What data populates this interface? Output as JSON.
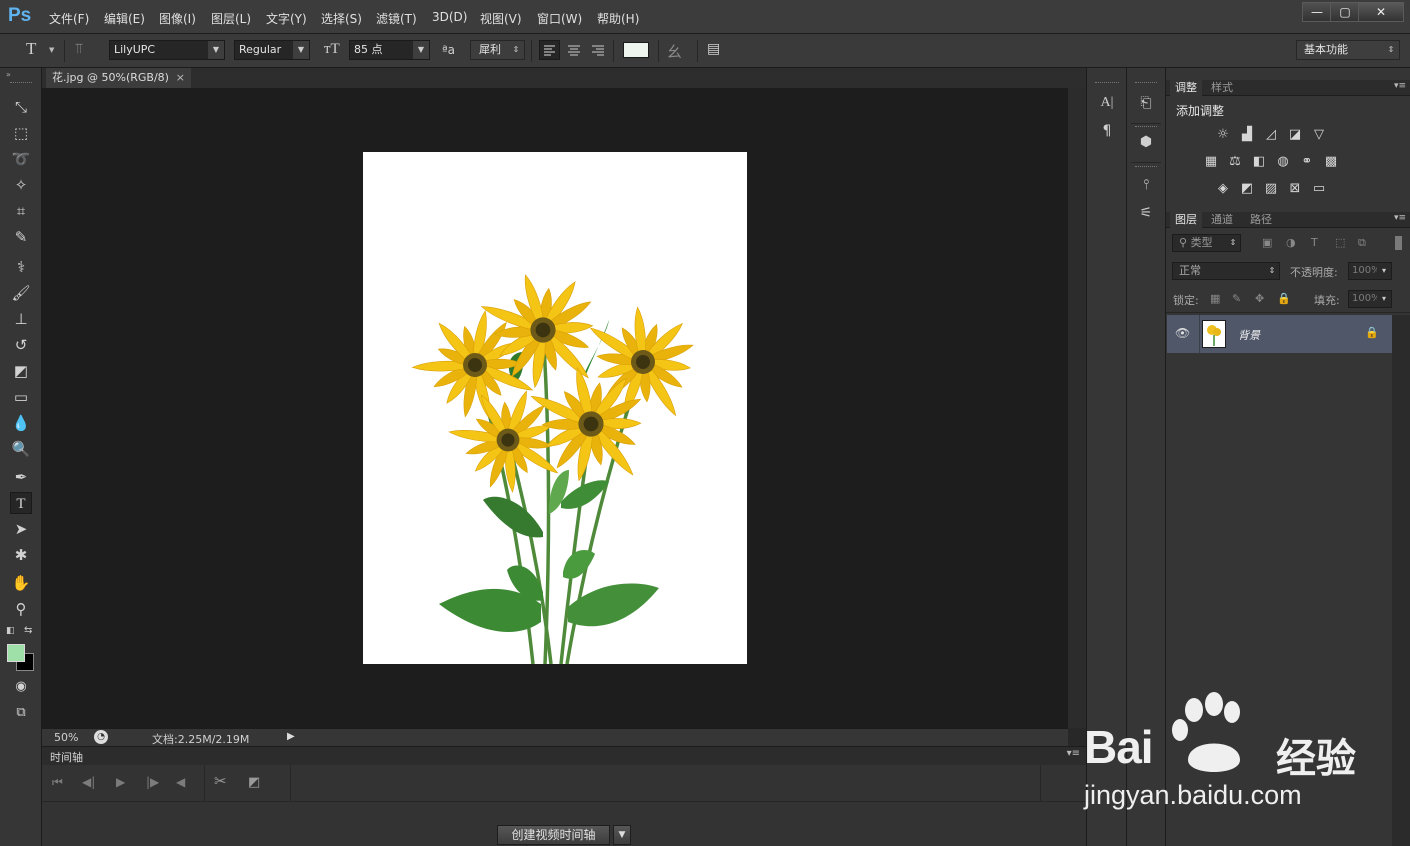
{
  "app": {
    "logo": "Ps"
  },
  "menu": [
    "文件(F)",
    "编辑(E)",
    "图像(I)",
    "图层(L)",
    "文字(Y)",
    "选择(S)",
    "滤镜(T)",
    "3D(D)",
    "视图(V)",
    "窗口(W)",
    "帮助(H)"
  ],
  "window_controls": [
    "—",
    "▢",
    "✕"
  ],
  "options": {
    "font_family": "LilyUPC",
    "font_style": "Regular",
    "font_size": "85 点",
    "antialias": "犀利",
    "color_swatch": "#eef5ee",
    "workspace": "基本功能"
  },
  "document": {
    "tab_title": "花.jpg @ 50%(RGB/8)",
    "close_glyph": "×",
    "image_alt": "yellow flowers"
  },
  "status": {
    "zoom": "50%",
    "doc_info": "文档:2.25M/2.19M"
  },
  "timeline": {
    "title": "时间轴",
    "create_button": "创建视频时间轴"
  },
  "toolbox": {
    "foreground_color": "#9fe0a8",
    "background_color": "#000000",
    "tools": [
      "move",
      "marquee",
      "lasso",
      "magic-wand",
      "crop",
      "eyedropper",
      "healing",
      "brush",
      "stamp",
      "history-brush",
      "eraser",
      "gradient",
      "blur",
      "dodge",
      "pen",
      "type",
      "path-select",
      "shape",
      "hand",
      "zoom"
    ]
  },
  "adjustments": {
    "tabs": [
      "调整",
      "样式"
    ],
    "title": "添加调整"
  },
  "layers": {
    "tabs": [
      "图层",
      "通道",
      "路径"
    ],
    "filter_kind": "类型",
    "blend_mode": "正常",
    "opacity_label": "不透明度:",
    "opacity_value": "100%",
    "lock_label": "锁定:",
    "fill_label": "填充:",
    "fill_value": "100%",
    "items": [
      {
        "name": "背景",
        "visible": true,
        "locked": true
      }
    ]
  },
  "watermark": {
    "brand": "Bai",
    "brand_cn": "经验",
    "url": "jingyan.baidu.com"
  }
}
